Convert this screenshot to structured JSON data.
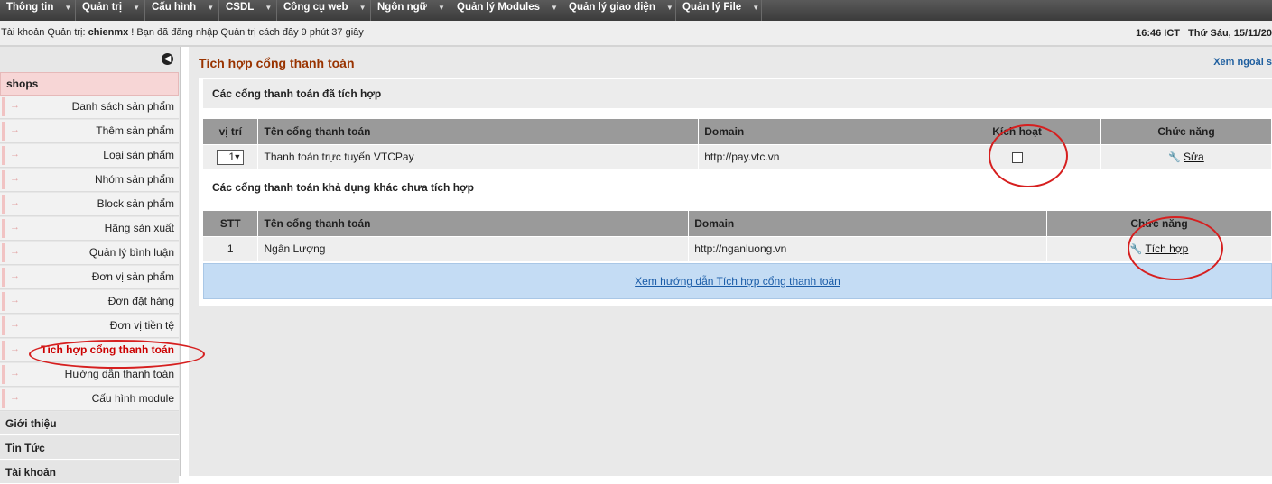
{
  "topnav": {
    "items": [
      {
        "label": "Thông tin"
      },
      {
        "label": "Quản trị"
      },
      {
        "label": "Cấu hình"
      },
      {
        "label": "CSDL"
      },
      {
        "label": "Công cụ web"
      },
      {
        "label": "Ngôn ngữ"
      },
      {
        "label": "Quản lý Modules"
      },
      {
        "label": "Quản lý giao diện"
      },
      {
        "label": "Quản lý File"
      }
    ]
  },
  "infobar": {
    "account_prefix": "Tài khoản Quản trị: ",
    "username": "chienmx",
    "login_text": " ! Bạn đã đăng nhập Quản trị cách đây 9 phút 37 giây",
    "time": "16:46 ICT",
    "date": "Thứ Sáu, 15/11/20"
  },
  "sidebar": {
    "active_category": "shops",
    "items": [
      {
        "label": "Danh sách sản phẩm"
      },
      {
        "label": "Thêm sản phẩm"
      },
      {
        "label": "Loại sản phẩm"
      },
      {
        "label": "Nhóm sản phẩm"
      },
      {
        "label": "Block sản phẩm"
      },
      {
        "label": "Hãng sản xuất"
      },
      {
        "label": "Quản lý bình luận"
      },
      {
        "label": "Đơn vị sản phẩm"
      },
      {
        "label": "Đơn đặt hàng"
      },
      {
        "label": "Đơn vị tiền tệ"
      },
      {
        "label": "Tích hợp cổng thanh toán"
      },
      {
        "label": "Hướng dẫn thanh toán"
      },
      {
        "label": "Cấu hình module"
      }
    ],
    "categories": [
      {
        "label": "Giới thiệu"
      },
      {
        "label": "Tin Tức"
      },
      {
        "label": "Tài khoản"
      }
    ]
  },
  "main": {
    "title": "Tích hợp cổng thanh toán",
    "top_right_link": "Xem ngoài s",
    "integrated_section": "Các cổng thanh toán đã tích hợp",
    "integrated_headers": {
      "pos": "vị trí",
      "name": "Tên cổng thanh toán",
      "domain": "Domain",
      "active": "Kích hoạt",
      "func": "Chức năng"
    },
    "integrated_rows": [
      {
        "pos": "1",
        "name": "Thanh toán trực tuyến VTCPay",
        "domain": "http://pay.vtc.vn",
        "action": "Sửa"
      }
    ],
    "available_section": "Các cổng thanh toán khả dụng khác chưa tích hợp",
    "available_headers": {
      "stt": "STT",
      "name": "Tên cổng thanh toán",
      "domain": "Domain",
      "func": "Chức năng"
    },
    "available_rows": [
      {
        "stt": "1",
        "name": "Ngân Lượng",
        "domain": "http://nganluong.vn",
        "action": "Tích hợp"
      }
    ],
    "guide_link": "Xem hướng dẫn Tích hợp cổng thanh toán"
  }
}
